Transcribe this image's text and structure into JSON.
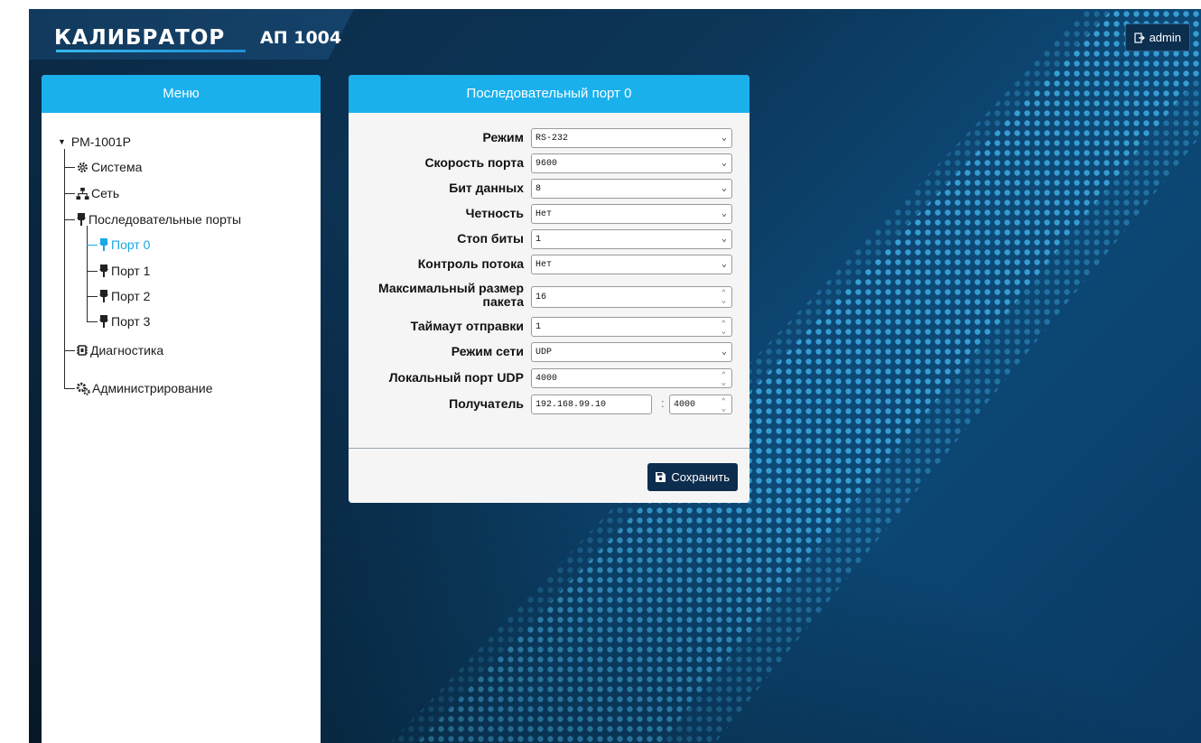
{
  "header": {
    "logo_text": "КАЛИБРАТОР",
    "model": "АП 1004",
    "user_button": "admin",
    "colors": {
      "accent": "#1ab0ec",
      "dark": "#0d2d4e"
    }
  },
  "menu": {
    "title": "Меню",
    "device": "РМ-1001Р",
    "items": [
      {
        "label": "Система",
        "icon": "gear-icon"
      },
      {
        "label": "Сеть",
        "icon": "network-icon"
      },
      {
        "label": "Последовательные порты",
        "icon": "serial-icon"
      },
      {
        "label": "Порт 0",
        "icon": "serial-icon",
        "active": true
      },
      {
        "label": "Порт 1",
        "icon": "serial-icon"
      },
      {
        "label": "Порт 2",
        "icon": "serial-icon"
      },
      {
        "label": "Порт 3",
        "icon": "serial-icon"
      },
      {
        "label": "Диагностика",
        "icon": "diagnostics-icon"
      },
      {
        "label": "Администрирование",
        "icon": "admin-gears-icon"
      }
    ]
  },
  "form": {
    "title": "Последовательный порт 0",
    "fields": [
      {
        "label": "Режим",
        "value": "RS-232",
        "kind": "select"
      },
      {
        "label": "Скорость порта",
        "value": "9600",
        "kind": "select"
      },
      {
        "label": "Бит данных",
        "value": "8",
        "kind": "select"
      },
      {
        "label": "Четность",
        "value": "Нет",
        "kind": "select"
      },
      {
        "label": "Стоп биты",
        "value": "1",
        "kind": "select"
      },
      {
        "label": "Контроль потока",
        "value": "Нет",
        "kind": "select"
      },
      {
        "label_line1": "Максимальный размер",
        "label_line2": "пакета",
        "value": "16",
        "kind": "number"
      },
      {
        "label": "Таймаут отправки",
        "value": "1",
        "kind": "number"
      },
      {
        "label": "Режим сети",
        "value": "UDP",
        "kind": "select"
      },
      {
        "label": "Локальный порт UDP",
        "value": "4000",
        "kind": "number"
      }
    ],
    "recipient": {
      "label": "Получатель",
      "ip": "192.168.99.10",
      "separator": ":",
      "port": "4000"
    },
    "save_label": "Сохранить"
  }
}
